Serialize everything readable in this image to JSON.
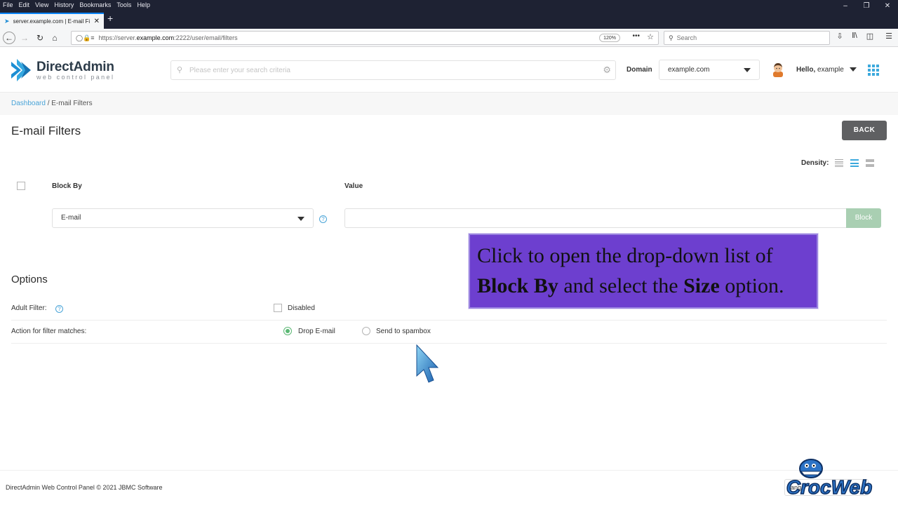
{
  "browser": {
    "menu": [
      "File",
      "Edit",
      "View",
      "History",
      "Bookmarks",
      "Tools",
      "Help"
    ],
    "tab_title": "server.example.com | E-mail Fi",
    "url_prefix": "https://server.",
    "url_domain": "example.com",
    "url_rest": ":2222/user/email/filters",
    "zoom": "120%",
    "search_placeholder": "Search"
  },
  "header": {
    "logo_name": "DirectAdmin",
    "logo_tagline": "web control panel",
    "search_placeholder": "Please enter your search criteria",
    "domain_label": "Domain",
    "domain_value": "example.com",
    "hello_label": "Hello,",
    "hello_user": "example"
  },
  "breadcrumb": {
    "home": "Dashboard",
    "separator": " / ",
    "current": "E-mail Filters"
  },
  "page": {
    "title": "E-mail Filters",
    "back_label": "BACK",
    "density_label": "Density:"
  },
  "filter_form": {
    "col_block_by": "Block By",
    "col_value": "Value",
    "block_by_value": "E-mail",
    "help_icon": "?",
    "value_input": "",
    "block_button": "Block"
  },
  "options": {
    "title": "Options",
    "adult_filter_label": "Adult Filter:",
    "adult_filter_option": "Disabled",
    "action_label": "Action for filter matches:",
    "action_drop": "Drop E-mail",
    "action_spambox": "Send to spambox"
  },
  "tutorial": {
    "line1": "Click to open the drop-down list of",
    "bold1": "Block By",
    "middle": " and select the ",
    "bold2": "Size",
    "end": " option."
  },
  "footer": {
    "copyright": "DirectAdmin Web Control Panel © 2021 JBMC Software",
    "lang_partial": "ang"
  },
  "watermark": {
    "text": "CrocWeb"
  },
  "colors": {
    "accent": "#3ca9dd",
    "callout_bg": "#6d3fcf",
    "block_btn": "#a9cfb2",
    "radio_on": "#5bb874"
  }
}
